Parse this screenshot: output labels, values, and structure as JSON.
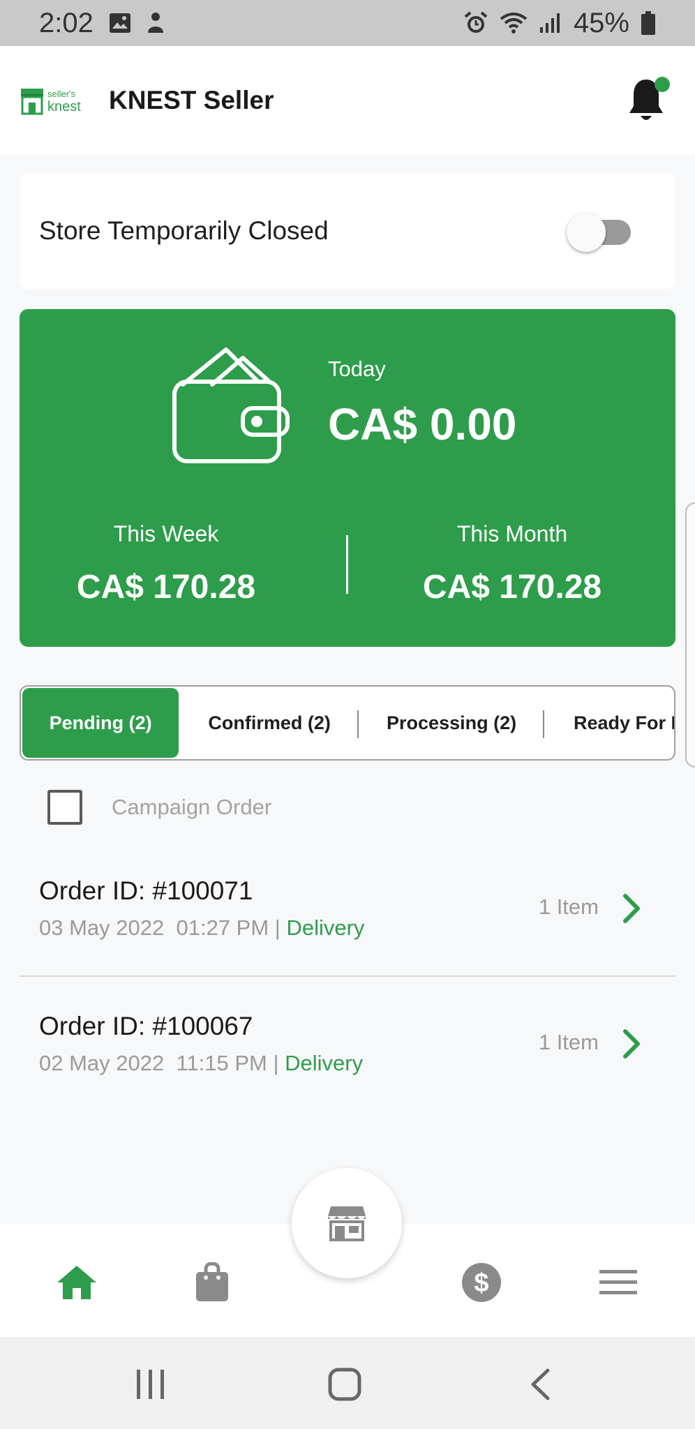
{
  "status_bar": {
    "time": "2:02",
    "battery": "45%",
    "icons": [
      "image-icon",
      "silhouette-icon",
      "alarm-icon",
      "wifi-icon",
      "signal-icon",
      "battery-icon"
    ]
  },
  "header": {
    "logo_text_top": "seller's",
    "logo_text_bottom": "knest",
    "title": "KNEST Seller",
    "notification_icon": "bell-icon"
  },
  "store": {
    "label": "Store Temporarily Closed",
    "toggle_on": false
  },
  "earnings": {
    "today_label": "Today",
    "today_value": "CA$ 0.00",
    "week_label": "This Week",
    "week_value": "CA$ 170.28",
    "month_label": "This Month",
    "month_value": "CA$ 170.28"
  },
  "tabs": [
    {
      "label": "Pending (2)",
      "active": true
    },
    {
      "label": "Confirmed (2)",
      "active": false
    },
    {
      "label": "Processing (2)",
      "active": false
    },
    {
      "label": "Ready For H",
      "active": false
    }
  ],
  "campaign": {
    "label": "Campaign Order",
    "checked": false
  },
  "orders": [
    {
      "id": "Order ID: #100071",
      "date": "03 May 2022",
      "time": "01:27 PM",
      "type": "Delivery",
      "items": "1 Item"
    },
    {
      "id": "Order ID: #100067",
      "date": "02 May 2022",
      "time": "11:15 PM",
      "type": "Delivery",
      "items": "1 Item"
    }
  ],
  "bottom_nav": {
    "items": [
      "home-icon",
      "shopping-bag-icon",
      "store-icon",
      "dollar-icon",
      "menu-icon"
    ],
    "active": "home-icon"
  },
  "colors": {
    "accent": "#2e9d4b",
    "muted": "#9a9a9a"
  }
}
